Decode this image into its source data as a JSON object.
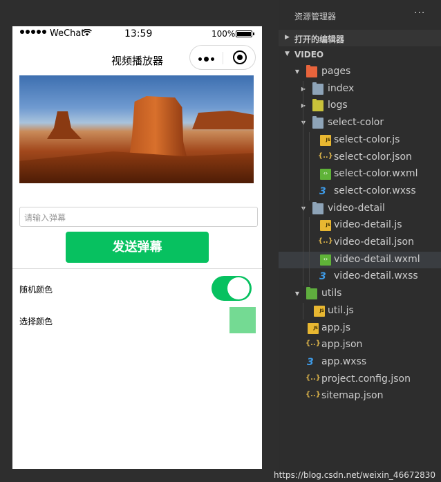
{
  "simulator": {
    "status_bar": {
      "carrier": "WeChat",
      "time": "13:59",
      "battery": "100%"
    },
    "nav_title": "视频播放器",
    "danmu_placeholder": "请输入弹幕",
    "send_button": "发送弹幕",
    "random_color_label": "随机颜色",
    "random_color_on": true,
    "select_color_label": "选择颜色",
    "selected_color": "#74da93",
    "accent_color": "#07c160"
  },
  "explorer": {
    "title": "资源管理器",
    "more": "···",
    "open_editors": "打开的编辑器",
    "project": "VIDEO",
    "tree": [
      {
        "label": "pages",
        "icon": "folder-pages-open-icon",
        "state": "expanded"
      },
      {
        "label": "index",
        "icon": "folder-icon",
        "state": "collapsed"
      },
      {
        "label": "logs",
        "icon": "folder-logs-icon",
        "state": "collapsed"
      },
      {
        "label": "select-color",
        "icon": "folder-open-icon",
        "state": "expanded"
      },
      {
        "label": "select-color.js",
        "icon": "js-file-icon"
      },
      {
        "label": "select-color.json",
        "icon": "json-file-icon"
      },
      {
        "label": "select-color.wxml",
        "icon": "wxml-file-icon"
      },
      {
        "label": "select-color.wxss",
        "icon": "wxss-file-icon"
      },
      {
        "label": "video-detail",
        "icon": "folder-open-icon",
        "state": "expanded"
      },
      {
        "label": "video-detail.js",
        "icon": "js-file-icon"
      },
      {
        "label": "video-detail.json",
        "icon": "json-file-icon"
      },
      {
        "label": "video-detail.wxml",
        "icon": "wxml-file-icon",
        "selected": true
      },
      {
        "label": "video-detail.wxss",
        "icon": "wxss-file-icon"
      },
      {
        "label": "utils",
        "icon": "folder-utils-open-icon",
        "state": "expanded"
      },
      {
        "label": "util.js",
        "icon": "js-file-icon"
      },
      {
        "label": "app.js",
        "icon": "js-file-icon"
      },
      {
        "label": "app.json",
        "icon": "json-file-icon"
      },
      {
        "label": "app.wxss",
        "icon": "wxss-file-icon"
      },
      {
        "label": "project.config.json",
        "icon": "json-file-icon"
      },
      {
        "label": "sitemap.json",
        "icon": "json-file-icon"
      }
    ]
  },
  "watermark": "https://blog.csdn.net/weixin_46672830"
}
